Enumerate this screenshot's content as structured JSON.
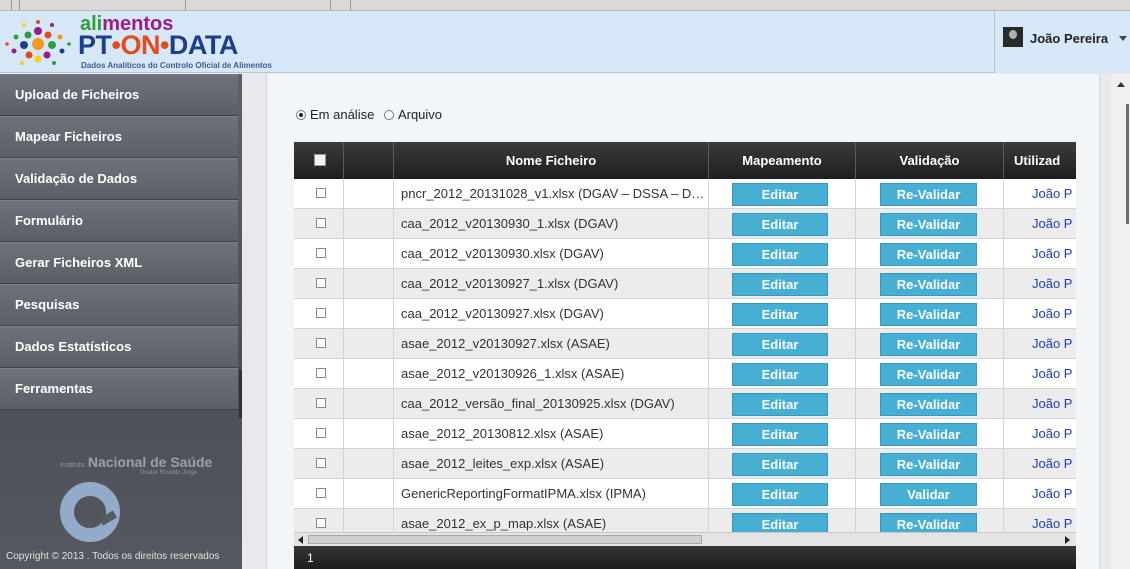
{
  "header": {
    "logo_line1_a": "ali",
    "logo_line1_b": "mentos",
    "logo_pt": "PT",
    "logo_on": "ON",
    "logo_data": "DATA",
    "logo_subtitle": "Dados Analíticos do Controlo Oficial de Alimentos",
    "user_name": "João Pereira"
  },
  "sidebar": {
    "items": [
      {
        "label": "Upload de Ficheiros"
      },
      {
        "label": "Mapear Ficheiros"
      },
      {
        "label": "Validação de Dados"
      },
      {
        "label": "Formulário"
      },
      {
        "label": "Gerar Ficheiros XML"
      },
      {
        "label": "Pesquisas"
      },
      {
        "label": "Dados Estatísticos"
      },
      {
        "label": "Ferramentas"
      }
    ],
    "institute_prefix": "Instituto",
    "institute_name": "Nacional de Saúde",
    "institute_sub": "Doutor Ricardo Jorge",
    "copyright": "Copyright © 2013 . Todos os direitos reservados"
  },
  "filter": {
    "option_analysis": "Em análise",
    "option_archive": "Arquivo",
    "selected": "Em análise"
  },
  "grid": {
    "columns": [
      "Nome Ficheiro",
      "Mapeamento",
      "Validação",
      "Utilizad"
    ],
    "rows": [
      {
        "file": "pncr_2012_20131028_v1.xlsx (DGAV – DSSA – D…",
        "map": "Editar",
        "val": "Re-Validar",
        "user": "João P"
      },
      {
        "file": "caa_2012_v20130930_1.xlsx (DGAV)",
        "map": "Editar",
        "val": "Re-Validar",
        "user": "João P"
      },
      {
        "file": "caa_2012_v20130930.xlsx (DGAV)",
        "map": "Editar",
        "val": "Re-Validar",
        "user": "João P"
      },
      {
        "file": "caa_2012_v20130927_1.xlsx (DGAV)",
        "map": "Editar",
        "val": "Re-Validar",
        "user": "João P"
      },
      {
        "file": "caa_2012_v20130927.xlsx (DGAV)",
        "map": "Editar",
        "val": "Re-Validar",
        "user": "João P"
      },
      {
        "file": "asae_2012_v20130927.xlsx (ASAE)",
        "map": "Editar",
        "val": "Re-Validar",
        "user": "João P"
      },
      {
        "file": "asae_2012_v20130926_1.xlsx (ASAE)",
        "map": "Editar",
        "val": "Re-Validar",
        "user": "João P"
      },
      {
        "file": "caa_2012_versão_final_20130925.xlsx (DGAV)",
        "map": "Editar",
        "val": "Re-Validar",
        "user": "João P"
      },
      {
        "file": "asae_2012_20130812.xlsx (ASAE)",
        "map": "Editar",
        "val": "Re-Validar",
        "user": "João P"
      },
      {
        "file": "asae_2012_leites_exp.xlsx (ASAE)",
        "map": "Editar",
        "val": "Re-Validar",
        "user": "João P"
      },
      {
        "file": "GenericReportingFormatIPMA.xlsx (IPMA)",
        "map": "Editar",
        "val": "Validar",
        "user": "João P"
      },
      {
        "file": "asae_2012_ex_p_map.xlsx (ASAE)",
        "map": "Editar",
        "val": "Re-Validar",
        "user": "João P"
      }
    ]
  },
  "pager": {
    "page": "1"
  }
}
